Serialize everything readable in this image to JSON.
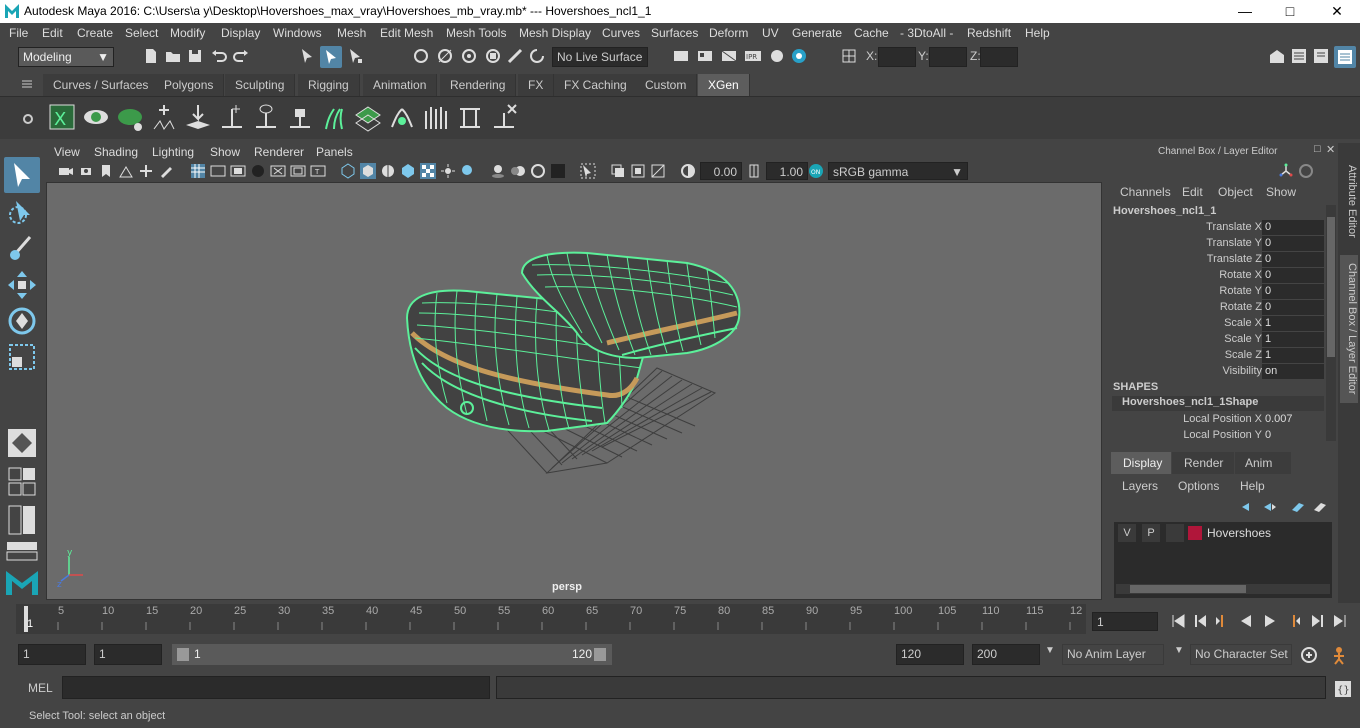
{
  "window": {
    "title": "Autodesk Maya 2016: C:\\Users\\a y\\Desktop\\Hovershoes_max_vray\\Hovershoes_mb_vray.mb*   ---   Hovershoes_ncl1_1",
    "min_icon": "minimize-icon",
    "max_icon": "maximize-icon",
    "close_icon": "close-icon"
  },
  "menubar": [
    "File",
    "Edit",
    "Create",
    "Select",
    "Modify",
    "Display",
    "Windows",
    "Mesh",
    "Edit Mesh",
    "Mesh Tools",
    "Mesh Display",
    "Curves",
    "Surfaces",
    "Deform",
    "UV",
    "Generate",
    "Cache",
    "- 3DtoAll -",
    "Redshift",
    "Help"
  ],
  "statusline": {
    "mode": "Modeling",
    "live_surface": "No Live Surface",
    "x_label": "X:",
    "y_label": "Y:",
    "z_label": "Z:"
  },
  "shelf": {
    "tabs": [
      "Curves / Surfaces",
      "Polygons",
      "Sculpting",
      "Rigging",
      "Animation",
      "Rendering",
      "FX",
      "FX Caching",
      "Custom",
      "XGen"
    ],
    "active_tab": "XGen"
  },
  "viewport": {
    "menu": [
      "View",
      "Shading",
      "Lighting",
      "Show",
      "Renderer",
      "Panels"
    ],
    "exposure": "0.00",
    "gamma": "1.00",
    "colorspace": "sRGB gamma",
    "camera_label": "persp"
  },
  "channelbox": {
    "header": "Channel Box / Layer Editor",
    "menu": [
      "Channels",
      "Edit",
      "Object",
      "Show"
    ],
    "object_name": "Hovershoes_ncl1_1",
    "attributes": [
      {
        "label": "Translate X",
        "value": "0"
      },
      {
        "label": "Translate Y",
        "value": "0"
      },
      {
        "label": "Translate Z",
        "value": "0"
      },
      {
        "label": "Rotate X",
        "value": "0"
      },
      {
        "label": "Rotate Y",
        "value": "0"
      },
      {
        "label": "Rotate Z",
        "value": "0"
      },
      {
        "label": "Scale X",
        "value": "1"
      },
      {
        "label": "Scale Y",
        "value": "1"
      },
      {
        "label": "Scale Z",
        "value": "1"
      },
      {
        "label": "Visibility",
        "value": "on"
      }
    ],
    "shapes_header": "SHAPES",
    "shape_name": "Hovershoes_ncl1_1Shape",
    "shape_attributes": [
      {
        "label": "Local Position X",
        "value": "0.007"
      },
      {
        "label": "Local Position Y",
        "value": "0"
      }
    ],
    "side_tabs": [
      "Attribute Editor",
      "Channel Box / Layer Editor"
    ]
  },
  "layereditor": {
    "tabs": [
      "Display",
      "Render",
      "Anim"
    ],
    "active_tab": "Display",
    "menu": [
      "Layers",
      "Options",
      "Help"
    ],
    "layers": [
      {
        "v": "V",
        "p": "P",
        "name": "Hovershoes",
        "color": "#b0163a"
      }
    ]
  },
  "timeline": {
    "ticks": [
      "5",
      "10",
      "15",
      "20",
      "25",
      "30",
      "35",
      "40",
      "45",
      "50",
      "55",
      "60",
      "65",
      "70",
      "75",
      "80",
      "85",
      "90",
      "95",
      "100",
      "105",
      "110",
      "115",
      "12"
    ],
    "start_marker": "1",
    "current_frame": "1"
  },
  "range": {
    "start": "1",
    "anim_start": "1",
    "slider_start": "1",
    "slider_end": "120",
    "end": "120",
    "anim_end": "200",
    "anim_layer": "No Anim Layer",
    "char_set": "No Character Set"
  },
  "cmdline": {
    "label": "MEL"
  },
  "helpline": {
    "text": "Select Tool: select an object"
  },
  "colors": {
    "wire": "#5cf09a",
    "accent": "#5d5d5d",
    "layer": "#b0163a",
    "bg": "#444444"
  }
}
